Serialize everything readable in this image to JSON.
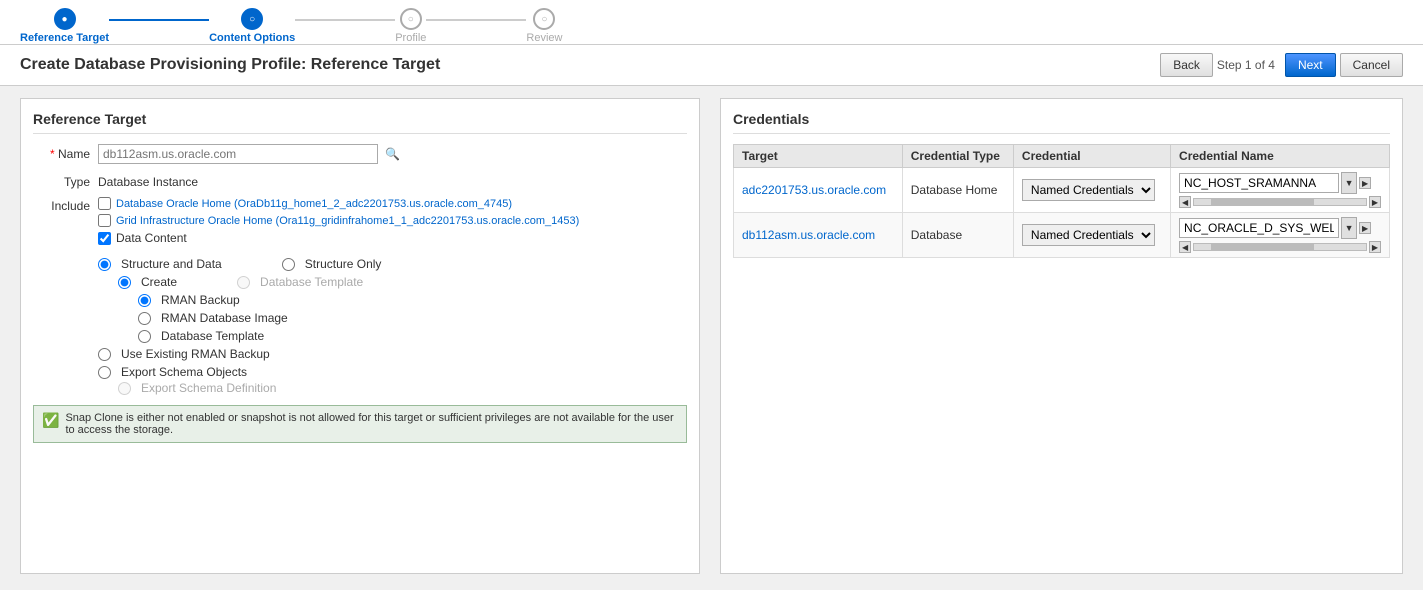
{
  "wizard": {
    "steps": [
      {
        "id": "reference-target",
        "label": "Reference Target",
        "state": "active"
      },
      {
        "id": "content-options",
        "label": "Content Options",
        "state": "done"
      },
      {
        "id": "profile",
        "label": "Profile",
        "state": "inactive"
      },
      {
        "id": "review",
        "label": "Review",
        "state": "inactive"
      }
    ]
  },
  "header": {
    "title": "Create Database Provisioning Profile: Reference Target",
    "back_label": "Back",
    "step_info": "Step 1 of 4",
    "next_label": "Next",
    "cancel_label": "Cancel"
  },
  "left": {
    "section_title": "Reference Target",
    "name_label": "Name",
    "name_placeholder": "db112asm.us.oracle.com",
    "type_label": "Type",
    "type_value": "Database Instance",
    "include_label": "Include",
    "checkbox1_label": "Database Oracle Home (OraDb11g_home1_2_adc2201753.us.oracle.com_4745)",
    "checkbox2_label": "Grid Infrastructure Oracle Home (Ora11g_gridinfrahome1_1_adc2201753.us.oracle.com_1453)",
    "data_content_label": "Data Content",
    "radio_structure_data": "Structure and Data",
    "radio_structure_only": "Structure Only",
    "radio_create": "Create",
    "radio_db_template_disabled": "Database Template",
    "radio_rman_backup": "RMAN Backup",
    "radio_rman_db_image": "RMAN Database Image",
    "radio_db_template": "Database Template",
    "radio_use_existing": "Use Existing RMAN Backup",
    "radio_export_schema": "Export Schema Objects",
    "radio_export_schema_disabled": "Export Schema Definition",
    "notice_text": "Snap Clone is either not enabled or snapshot is not allowed for this target or sufficient privileges are not available for the user to access the storage."
  },
  "right": {
    "section_title": "Credentials",
    "col_target": "Target",
    "col_cred_type": "Credential Type",
    "col_credential": "Credential",
    "col_cred_name": "Credential Name",
    "rows": [
      {
        "target": "adc2201753.us.oracle.com",
        "cred_type": "Database Home",
        "credential": "Named Credentials",
        "cred_name": "NC_HOST_SRAMANNA"
      },
      {
        "target": "db112asm.us.oracle.com",
        "cred_type": "Database",
        "credential": "Named Credentials",
        "cred_name": "NC_ORACLE_D_SYS_WELCOME"
      }
    ]
  }
}
